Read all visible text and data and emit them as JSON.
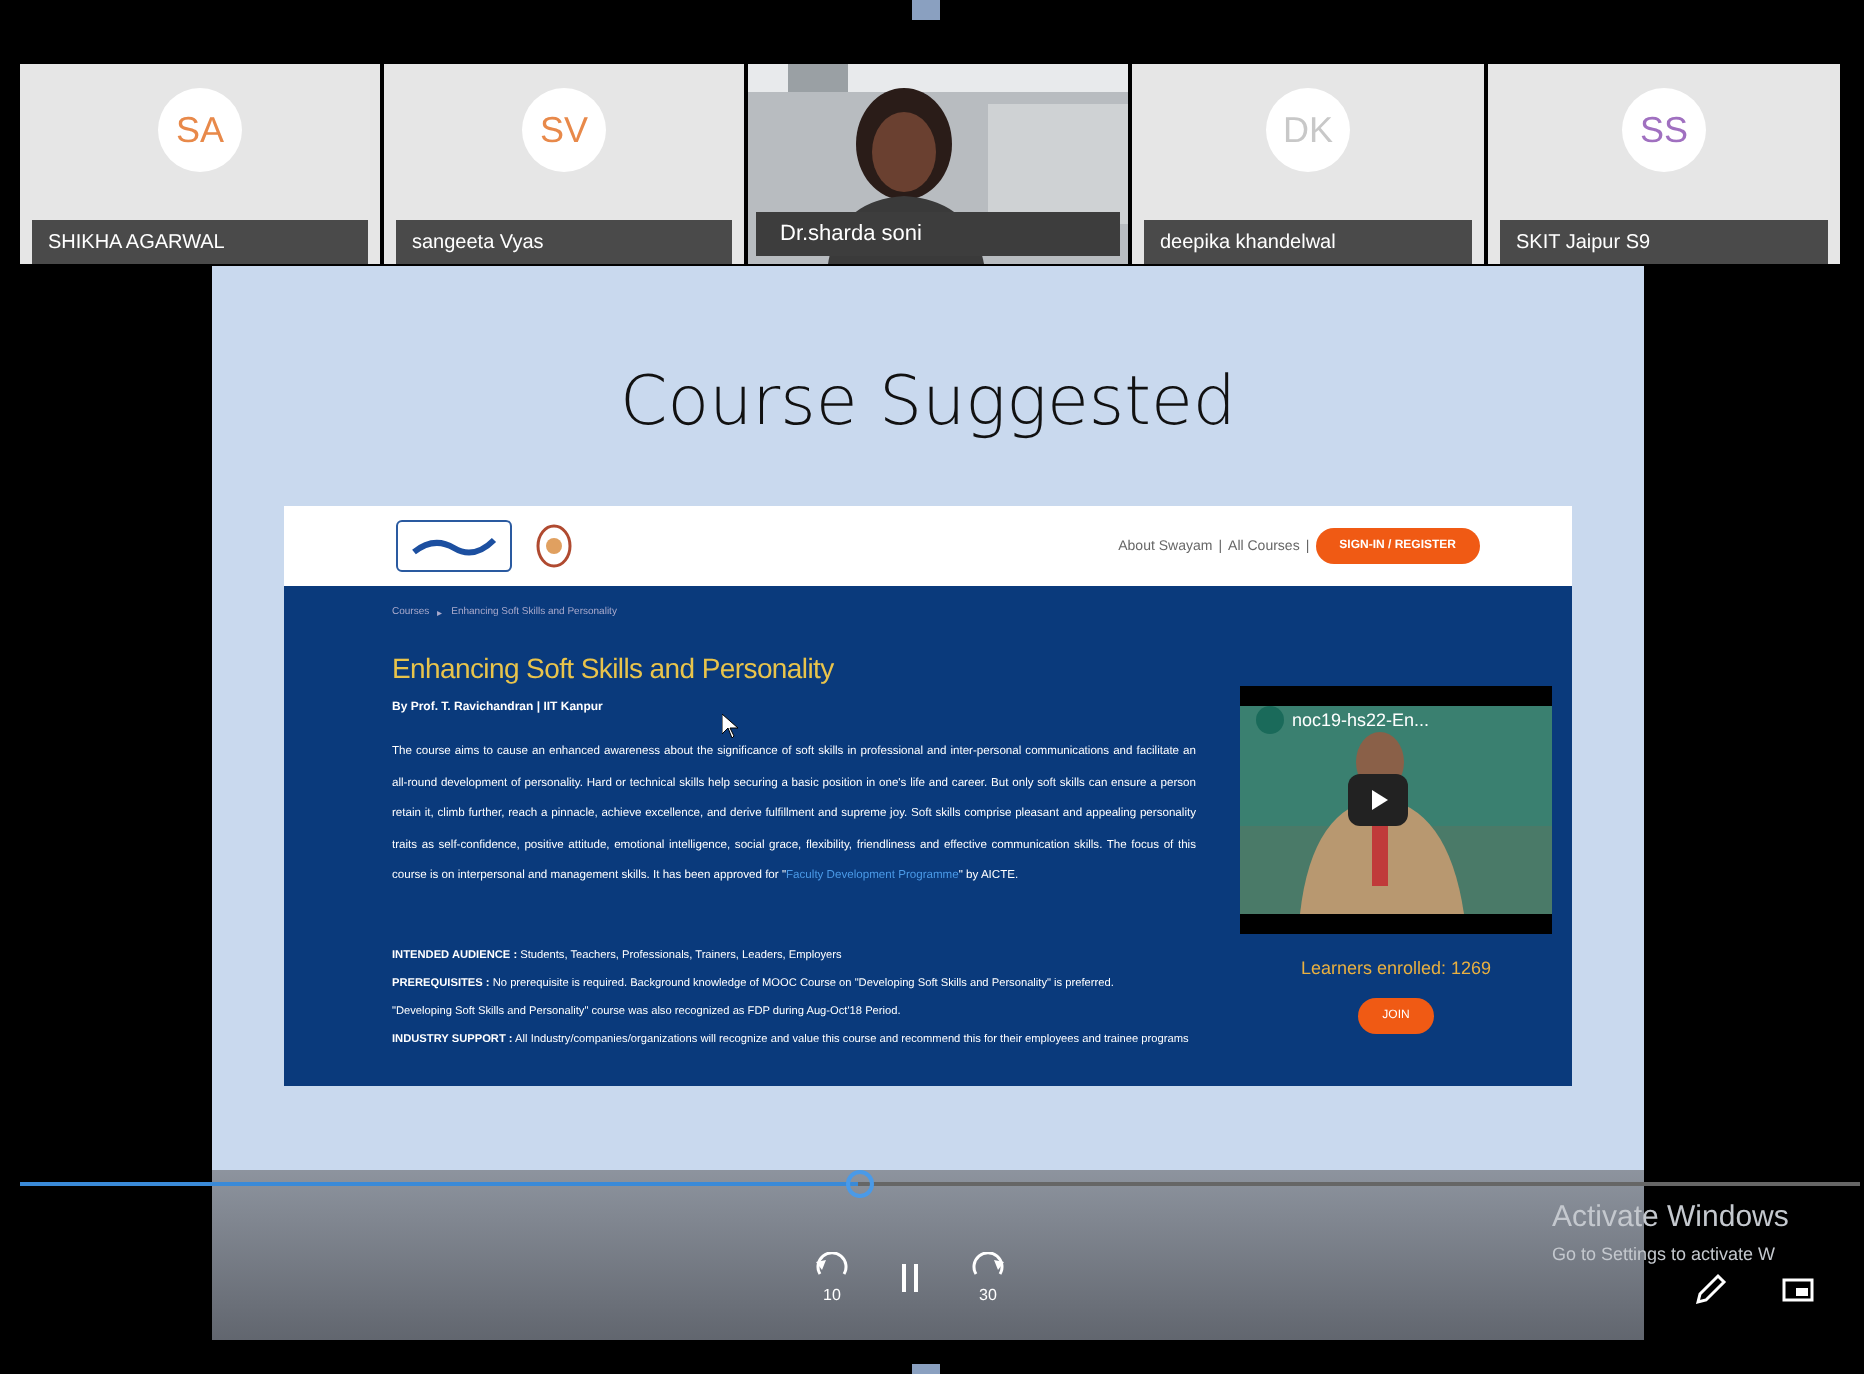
{
  "participants": [
    {
      "kind": "avatar",
      "initials": "SA",
      "color": "#e8894a",
      "name": "SHIKHA AGARWAL"
    },
    {
      "kind": "avatar",
      "initials": "SV",
      "color": "#e8894a",
      "name": "sangeeta Vyas"
    },
    {
      "kind": "video",
      "name": "Dr.sharda soni"
    },
    {
      "kind": "avatar",
      "initials": "DK",
      "color": "#c8c8c8",
      "name": "deepika khandelwal"
    },
    {
      "kind": "avatar",
      "initials": "SS",
      "color": "#a070c0",
      "name": "SKIT Jaipur S9"
    }
  ],
  "slide": {
    "title": "Course Suggested",
    "page": {
      "nav": [
        "About Swayam",
        "All Courses"
      ],
      "nav_separator": "|",
      "crumb_separator": "▸",
      "sign_in": "SIGN-IN / REGISTER",
      "breadcrumb": [
        "Courses",
        "Enhancing Soft Skills and Personality"
      ],
      "course_title": "Enhancing Soft Skills and Personality",
      "byline": "By Prof. T. Ravichandran  |  IIT Kanpur",
      "description": {
        "before": "The course aims to cause an enhanced awareness about the significance of soft skills in professional and inter-personal communications and facilitate an all-round development of personality. Hard or technical skills help securing a basic position in one's life and career. But only soft skills can ensure a person retain it, climb further, reach a pinnacle, achieve excellence, and derive fulfillment and supreme joy. Soft skills comprise pleasant and appealing personality traits as self-confidence, positive attitude, emotional intelligence, social grace, flexibility, friendliness and effective communication skills. The focus of this course is on interpersonal and management skills. It has been approved for \"",
        "link": "Faculty Development Programme",
        "after": "\" by AICTE."
      },
      "details": [
        "**INTENDED AUDIENCE :** Students, Teachers, Professionals, Trainers, Leaders, Employers",
        "**PREREQUISITES :** No prerequisite is required. Background knowledge of MOOC Course on \"Developing Soft Skills and Personality\" is preferred.",
        "\"Developing Soft Skills and Personality\" course was also recognized as FDP during Aug-Oct'18 Period.",
        "**INDUSTRY SUPPORT :** All Industry/companies/organizations will recognize and value this course and recommend this for their employees and trainee programs"
      ],
      "video_title": "noc19-hs22-En...",
      "learners": "Learners enrolled: 1269",
      "join": "JOIN"
    }
  },
  "player": {
    "level": 0.455,
    "rewind": "10",
    "forward": "30"
  },
  "notice": {
    "title": "Activate Windows",
    "subtitle": "Go to Settings to activate W"
  }
}
